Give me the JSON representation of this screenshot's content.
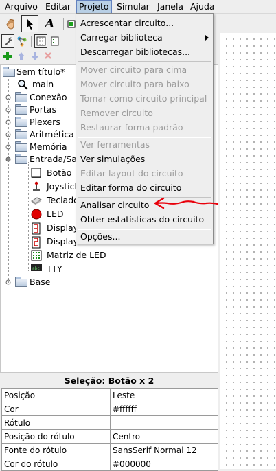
{
  "menubar": {
    "items": [
      "Arquivo",
      "Editar",
      "Projeto",
      "Simular",
      "Janela",
      "Ajuda"
    ]
  },
  "projeto_menu": {
    "items": [
      {
        "label": "Acrescentar circuito...",
        "enabled": true
      },
      {
        "label": "Carregar biblioteca",
        "enabled": true,
        "submenu": true
      },
      {
        "label": "Descarregar bibliotecas...",
        "enabled": true
      },
      {
        "label": "Mover circuito para cima",
        "enabled": false
      },
      {
        "label": "Mover circuito para baixo",
        "enabled": false
      },
      {
        "label": "Tomar como circuito principal",
        "enabled": false
      },
      {
        "label": "Remover circuito",
        "enabled": false
      },
      {
        "label": "Restaurar forma padrão",
        "enabled": false
      },
      {
        "label": "Ver ferramentas",
        "enabled": false
      },
      {
        "label": "Ver simulações",
        "enabled": true
      },
      {
        "label": "Editar layout do circuito",
        "enabled": false
      },
      {
        "label": "Editar forma do circuito",
        "enabled": true
      },
      {
        "label": "Analisar circuito",
        "enabled": true
      },
      {
        "label": "Obter estatísticas do circuito",
        "enabled": true
      },
      {
        "label": "Opções...",
        "enabled": true
      }
    ]
  },
  "tree": {
    "root": "Sem título*",
    "main": "main",
    "libraries": [
      "Conexão",
      "Portas",
      "Plexers",
      "Aritmética",
      "Memória",
      "Entrada/Saída",
      "Base"
    ],
    "io_items": [
      "Botão",
      "Joystick",
      "Teclado",
      "LED",
      "Display",
      "Display",
      "Matriz de LED",
      "TTY"
    ]
  },
  "toolbar": {
    "text_tool_glyph": "A"
  },
  "selection": {
    "title": "Seleção: Botão x 2",
    "rows": [
      {
        "key": "Posição",
        "value": "Leste"
      },
      {
        "key": "Cor",
        "value": "#ffffff"
      },
      {
        "key": "Rótulo",
        "value": ""
      },
      {
        "key": "Posição do rótulo",
        "value": "Centro"
      },
      {
        "key": "Fonte do rótulo",
        "value": "SansSerif Normal 12"
      },
      {
        "key": "Cor do rótulo",
        "value": "#000000"
      }
    ]
  },
  "colors": {
    "menu_highlight": "#b8cfe5",
    "annotation_arrow": "#e8000b",
    "disabled_text": "#9a9a9a"
  }
}
